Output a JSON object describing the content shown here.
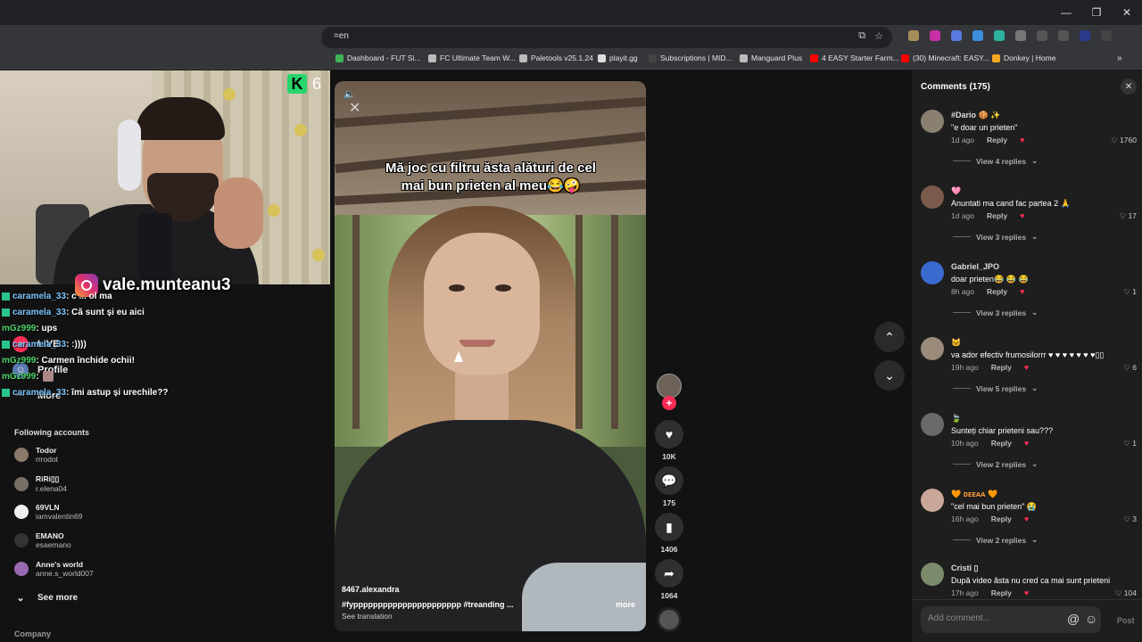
{
  "browser": {
    "url_fragment": "=en",
    "bookmarks": [
      {
        "label": "Dashboard - FUT Si...",
        "color": "#3db35a"
      },
      {
        "label": "FC Ultimate Team W...",
        "color": "#bbbbbb"
      },
      {
        "label": "Paletools v25.1.24",
        "color": "#bbbbbb"
      },
      {
        "label": "playit.gg",
        "color": "#dddddd"
      },
      {
        "label": "Subscriptions | MID...",
        "color": "#444444"
      },
      {
        "label": "Manguard Plus",
        "color": "#bbbbbb"
      },
      {
        "label": "4 EASY Starter Farm...",
        "color": "#ff0000"
      },
      {
        "label": "(30) Minecraft: EASY...",
        "color": "#ff0000"
      },
      {
        "label": "Donkey | Home",
        "color": "#f5a623"
      }
    ],
    "more_bookmarks_icon": "chevron-right-double"
  },
  "stream": {
    "badge_letter": "K",
    "badge_count": "6",
    "instagram_handle": "vale.munteanu3",
    "chat": [
      {
        "user": "caramela_33",
        "msg": ": c ... ol ma",
        "green": false
      },
      {
        "user": "caramela_33",
        "msg": ": Că sunt și eu aici",
        "green": false
      },
      {
        "user": "mGz999",
        "msg": ": ups",
        "green": true
      },
      {
        "user": "caramela_33",
        "msg": ": :))))",
        "green": false
      },
      {
        "user": "mGz999",
        "msg": ": Carmen închide ochii!",
        "green": true
      },
      {
        "user": "mGz999",
        "msg": ":",
        "green": true
      },
      {
        "user": "caramela_33",
        "msg": ": îmi astup și urechile??",
        "green": false
      }
    ]
  },
  "nav": {
    "items": [
      {
        "label": "LIVE",
        "icon": "live-icon"
      },
      {
        "label": "Profile",
        "icon": "profile-icon"
      },
      {
        "label": "More",
        "icon": "more-icon"
      }
    ],
    "following_title": "Following accounts",
    "accounts": [
      {
        "name": "Todor",
        "handle": "rrrodot"
      },
      {
        "name": "RiRi▯▯",
        "handle": "r.elena04"
      },
      {
        "name": "69VLN",
        "handle": "iamvalentin69"
      },
      {
        "name": "EMANO",
        "handle": "esaemano"
      },
      {
        "name": "Anne's world",
        "handle": "anne.s_world007"
      }
    ],
    "see_more": "See more",
    "company": "Company"
  },
  "video": {
    "caption": "Mă joc cu filtru ăsta alături de cel mai bun prieten al meu😂🤪",
    "author": "8467.alexandra",
    "tags": "#fypppppppppppppppppppppp  #treanding ...",
    "more": "more",
    "see_translation": "See translation",
    "likes": "10K",
    "comments": "175",
    "saves": "1406",
    "shares": "1064"
  },
  "comments": {
    "title": "Comments (175)",
    "items": [
      {
        "name": "#Dario 🍪 ✨",
        "text": "\"e doar un prieten\"",
        "time": "1d ago",
        "reply": "Reply",
        "likes": "♡ 1760",
        "view_replies": "View 4 replies"
      },
      {
        "name": "🩷",
        "text": "Anuntati ma cand fac partea 2 🙏",
        "time": "1d ago",
        "reply": "Reply",
        "likes": "♡ 17",
        "view_replies": "View 3 replies"
      },
      {
        "name": "Gabriel_JPO",
        "text": "doar prieten😂 😂 😂",
        "time": "8h ago",
        "reply": "Reply",
        "likes": "♡ 1",
        "view_replies": "View 3 replies"
      },
      {
        "name": "🐱",
        "text": "va ador efectiv frumosilorrr ♥ ♥ ♥ ♥ ♥ ♥ ♥▯▯",
        "time": "19h ago",
        "reply": "Reply",
        "likes": "♡ 6",
        "view_replies": "View 5 replies"
      },
      {
        "name": "🍃",
        "text": "Sunteți chiar prieteni sau???",
        "time": "10h ago",
        "reply": "Reply",
        "likes": "♡ 1",
        "view_replies": "View 2 replies"
      },
      {
        "name": "🧡 ᴅᴇᴇᴀᴀ 🧡",
        "text": "\"cel mai bun prieten\" 😭",
        "time": "16h ago",
        "reply": "Reply",
        "likes": "♡ 3",
        "view_replies": "View 2 replies"
      },
      {
        "name": "Cristi ▯",
        "text": "După video ăsta nu cred ca mai sunt prieteni",
        "time": "17h ago",
        "reply": "Reply",
        "likes": "♡ 104",
        "view_replies": ""
      }
    ],
    "placeholder": "Add comment...",
    "post": "Post"
  }
}
